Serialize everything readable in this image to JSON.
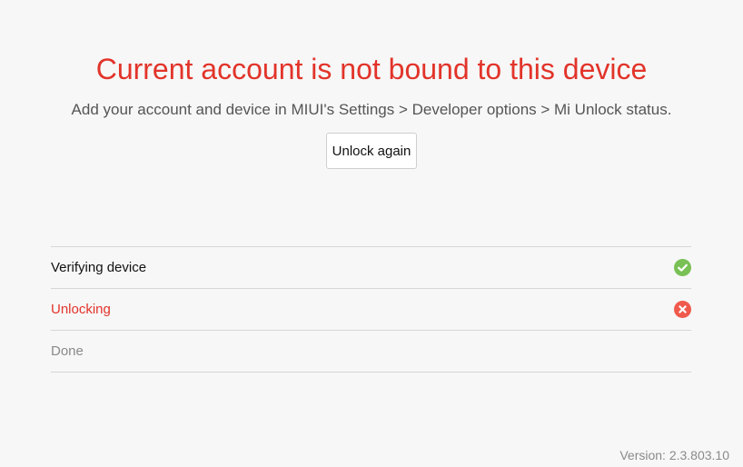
{
  "header": {
    "title": "Current account is not bound to this device",
    "subtitle": "Add your account and device in MIUI's Settings > Developer options > Mi Unlock status."
  },
  "actions": {
    "unlock_again_label": "Unlock again"
  },
  "steps": [
    {
      "label": "Verifying device",
      "status": "success",
      "icon": "check-circle-icon",
      "color": "#111111",
      "icon_color": "#79c055"
    },
    {
      "label": "Unlocking",
      "status": "error",
      "icon": "close-circle-icon",
      "color": "#e2342a",
      "icon_color": "#ef5a4c"
    },
    {
      "label": "Done",
      "status": "pending",
      "color": "#8a8a8a"
    }
  ],
  "footer": {
    "version": "Version: 2.3.803.10"
  },
  "colors": {
    "error_accent": "#e2342a",
    "success": "#79c055",
    "background": "#f7f7f7"
  }
}
